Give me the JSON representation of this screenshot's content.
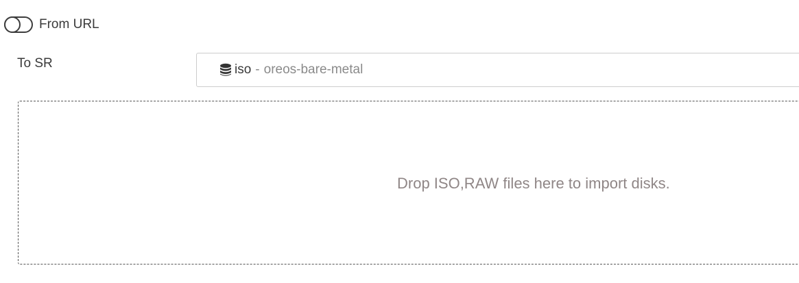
{
  "url_toggle": {
    "label": "From URL",
    "checked": false
  },
  "sr": {
    "label": "To SR",
    "icon": "database-icon",
    "name": "iso",
    "separator": "-",
    "host": "oreos-bare-metal"
  },
  "dropzone": {
    "text": "Drop ISO,RAW files here to import disks."
  }
}
